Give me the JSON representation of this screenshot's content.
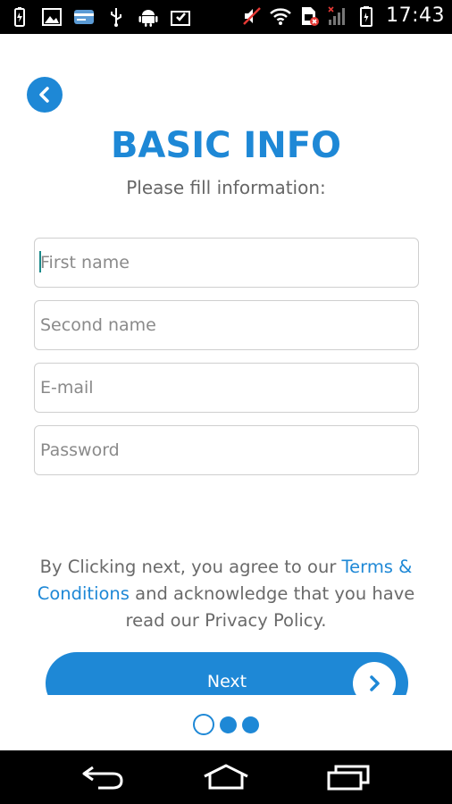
{
  "status_bar": {
    "time": "17:43",
    "icons": [
      "usb-battery-icon",
      "image-icon",
      "card-icon",
      "usb-icon",
      "android-icon",
      "email-check-icon",
      "mute-icon",
      "wifi-icon",
      "sim-error-icon",
      "signal-icon",
      "battery-icon"
    ]
  },
  "header": {
    "title": "BASIC INFO",
    "subtitle": "Please fill information:"
  },
  "form": {
    "first_name_placeholder": "First name",
    "second_name_placeholder": "Second name",
    "email_placeholder": "E-mail",
    "password_placeholder": "Password"
  },
  "terms": {
    "prefix": "By Clicking next, you agree to our ",
    "link": "Terms & Conditions",
    "suffix": " and acknowledge that you have read our Privacy Policy."
  },
  "next_button": {
    "label": "Next"
  },
  "pager": {
    "total": 3,
    "current": 1
  },
  "colors": {
    "accent": "#1e88d6",
    "text_gray": "#6a6a6a"
  }
}
